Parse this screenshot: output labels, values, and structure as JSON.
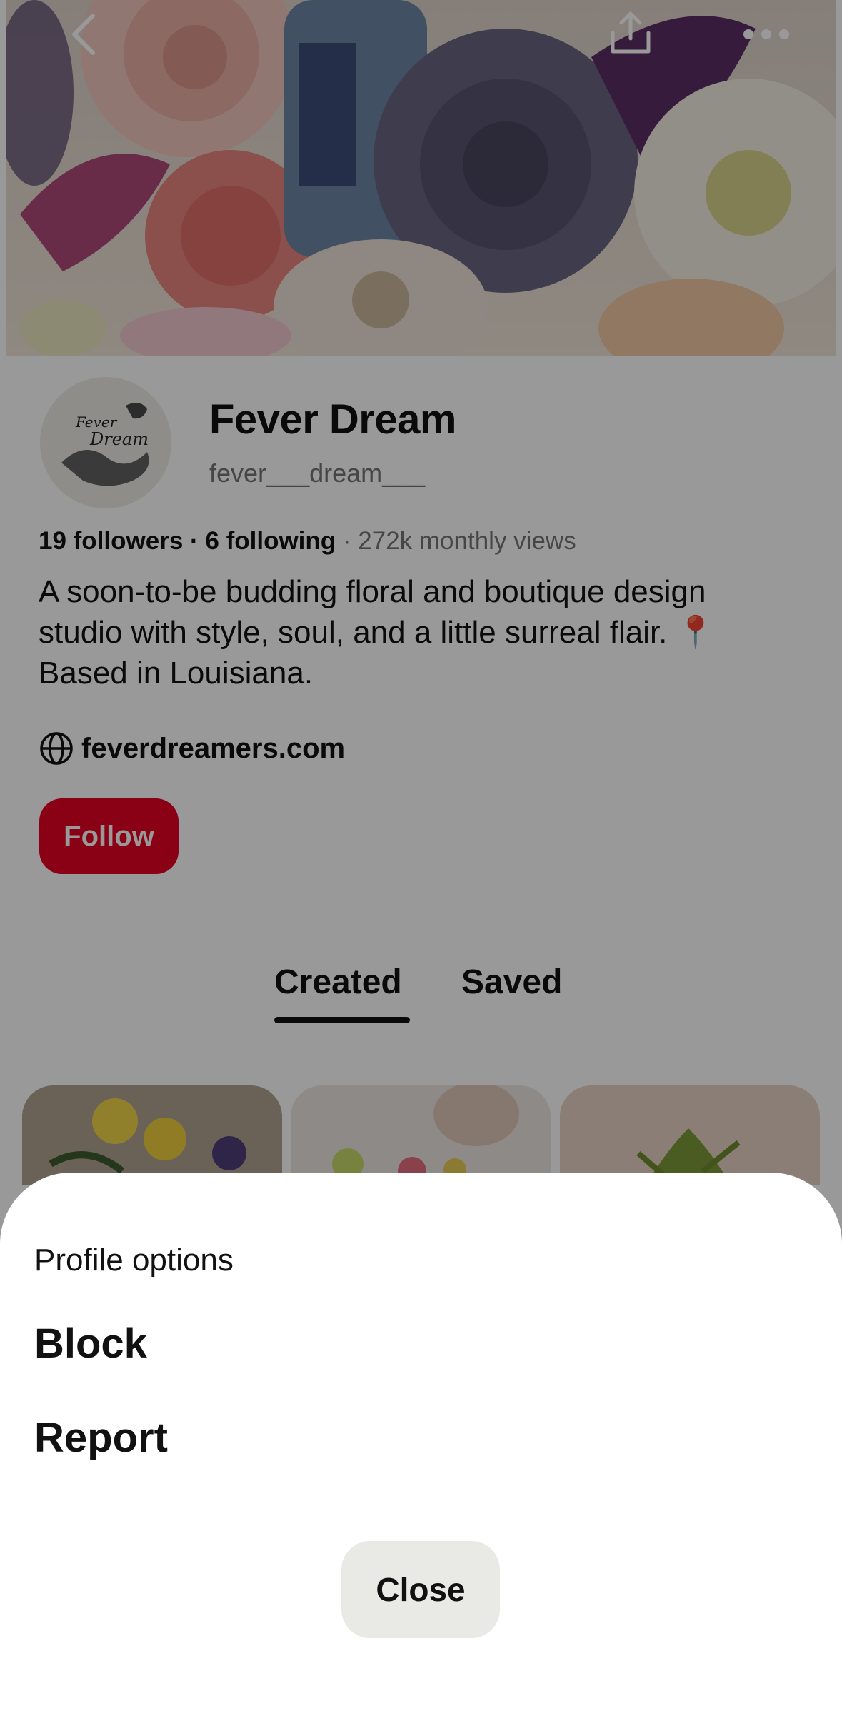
{
  "cover": {
    "back_icon": "chevron-left-icon",
    "share_icon": "share-upload-icon",
    "more_icon": "ellipsis-icon"
  },
  "profile": {
    "display_name": "Fever Dream",
    "handle": "fever___dream___",
    "avatar_logo_text": "Fever Dream",
    "stats": {
      "followers": "19 followers",
      "separator": " · ",
      "following": "6 following",
      "monthly_views": "272k monthly views"
    },
    "bio_lines": [
      "A soon-to-be budding floral and boutique design",
      "studio with style, soul, and a little surreal flair. 📍",
      "Based in Louisiana."
    ],
    "website": "feverdreamers.com",
    "follow_label": "Follow",
    "accent_color": "#e60023"
  },
  "tabs": [
    {
      "label": "Created",
      "active": true
    },
    {
      "label": "Saved",
      "active": false
    }
  ],
  "sheet": {
    "title": "Profile options",
    "items": [
      {
        "label": "Block"
      },
      {
        "label": "Report"
      }
    ],
    "close_label": "Close"
  }
}
